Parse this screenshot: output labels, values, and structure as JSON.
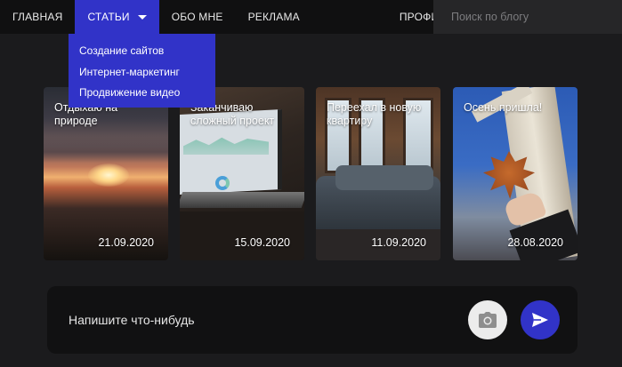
{
  "nav": {
    "items": [
      {
        "label": "ГЛАВНАЯ"
      },
      {
        "label": "СТАТЬИ"
      },
      {
        "label": "ОБО МНЕ"
      },
      {
        "label": "РЕКЛАМА"
      },
      {
        "label": "ПРОФИЛЬ"
      }
    ],
    "search_placeholder": "Поиск по блогу"
  },
  "dropdown": {
    "items": [
      {
        "label": "Создание сайтов"
      },
      {
        "label": "Интернет-маркетинг"
      },
      {
        "label": "Продвижение видео"
      }
    ]
  },
  "cards": [
    {
      "title": "Отдыхаю на природе",
      "date": "21.09.2020"
    },
    {
      "title": "Заканчиваю сложный проект",
      "date": "15.09.2020"
    },
    {
      "title": "Переехал в новую квартиру",
      "date": "11.09.2020"
    },
    {
      "title": "Осень пришла!",
      "date": "28.08.2020"
    }
  ],
  "composer": {
    "placeholder": "Напишите что-нибудь"
  },
  "colors": {
    "accent": "#3133c8",
    "background": "#1b1b1d",
    "nav_background": "#101011"
  }
}
